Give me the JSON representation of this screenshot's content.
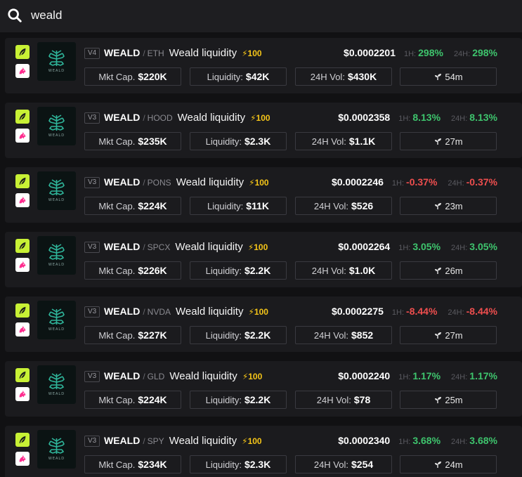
{
  "search": {
    "query": "weald",
    "icon": "search-icon"
  },
  "colors": {
    "up": "#3ec46d",
    "down": "#ee4e4e",
    "bolt": "#f5c518",
    "chain_top": "#c8f135",
    "chain_bottom": "#ffffff"
  },
  "results": [
    {
      "version": "V4",
      "symbol": "WEALD",
      "pair": "ETH",
      "name": "Weald liquidity",
      "score": "⚡100",
      "price": "$0.0002201",
      "h1_label": "1H:",
      "h1": "298%",
      "h1_dir": "up",
      "h24_label": "24H:",
      "h24": "298%",
      "h24_dir": "up",
      "mcap_label": "Mkt Cap.",
      "mcap": "$220K",
      "liq_label": "Liquidity:",
      "liq": "$42K",
      "vol_label": "24H Vol:",
      "vol": "$430K",
      "age": "54m",
      "logo_text": "WEALD"
    },
    {
      "version": "V3",
      "symbol": "WEALD",
      "pair": "HOOD",
      "name": "Weald liquidity",
      "score": "⚡100",
      "price": "$0.0002358",
      "h1_label": "1H:",
      "h1": "8.13%",
      "h1_dir": "up",
      "h24_label": "24H:",
      "h24": "8.13%",
      "h24_dir": "up",
      "mcap_label": "Mkt Cap.",
      "mcap": "$235K",
      "liq_label": "Liquidity:",
      "liq": "$2.3K",
      "vol_label": "24H Vol:",
      "vol": "$1.1K",
      "age": "27m",
      "logo_text": "WEALD"
    },
    {
      "version": "V3",
      "symbol": "WEALD",
      "pair": "PONS",
      "name": "Weald liquidity",
      "score": "⚡100",
      "price": "$0.0002246",
      "h1_label": "1H:",
      "h1": "-0.37%",
      "h1_dir": "down",
      "h24_label": "24H:",
      "h24": "-0.37%",
      "h24_dir": "down",
      "mcap_label": "Mkt Cap.",
      "mcap": "$224K",
      "liq_label": "Liquidity:",
      "liq": "$11K",
      "vol_label": "24H Vol:",
      "vol": "$526",
      "age": "23m",
      "logo_text": "WEALD"
    },
    {
      "version": "V3",
      "symbol": "WEALD",
      "pair": "SPCX",
      "name": "Weald liquidity",
      "score": "⚡100",
      "price": "$0.0002264",
      "h1_label": "1H:",
      "h1": "3.05%",
      "h1_dir": "up",
      "h24_label": "24H:",
      "h24": "3.05%",
      "h24_dir": "up",
      "mcap_label": "Mkt Cap.",
      "mcap": "$226K",
      "liq_label": "Liquidity:",
      "liq": "$2.2K",
      "vol_label": "24H Vol:",
      "vol": "$1.0K",
      "age": "26m",
      "logo_text": "WEALD"
    },
    {
      "version": "V3",
      "symbol": "WEALD",
      "pair": "NVDA",
      "name": "Weald liquidity",
      "score": "⚡100",
      "price": "$0.0002275",
      "h1_label": "1H:",
      "h1": "-8.44%",
      "h1_dir": "down",
      "h24_label": "24H:",
      "h24": "-8.44%",
      "h24_dir": "down",
      "mcap_label": "Mkt Cap.",
      "mcap": "$227K",
      "liq_label": "Liquidity:",
      "liq": "$2.2K",
      "vol_label": "24H Vol:",
      "vol": "$852",
      "age": "27m",
      "logo_text": "WEALD"
    },
    {
      "version": "V3",
      "symbol": "WEALD",
      "pair": "GLD",
      "name": "Weald liquidity",
      "score": "⚡100",
      "price": "$0.0002240",
      "h1_label": "1H:",
      "h1": "1.17%",
      "h1_dir": "up",
      "h24_label": "24H:",
      "h24": "1.17%",
      "h24_dir": "up",
      "mcap_label": "Mkt Cap.",
      "mcap": "$224K",
      "liq_label": "Liquidity:",
      "liq": "$2.2K",
      "vol_label": "24H Vol:",
      "vol": "$78",
      "age": "25m",
      "logo_text": "WEALD"
    },
    {
      "version": "V3",
      "symbol": "WEALD",
      "pair": "SPY",
      "name": "Weald liquidity",
      "score": "⚡100",
      "price": "$0.0002340",
      "h1_label": "1H:",
      "h1": "3.68%",
      "h1_dir": "up",
      "h24_label": "24H:",
      "h24": "3.68%",
      "h24_dir": "up",
      "mcap_label": "Mkt Cap.",
      "mcap": "$234K",
      "liq_label": "Liquidity:",
      "liq": "$2.3K",
      "vol_label": "24H Vol:",
      "vol": "$254",
      "age": "24m",
      "logo_text": "WEALD"
    }
  ]
}
